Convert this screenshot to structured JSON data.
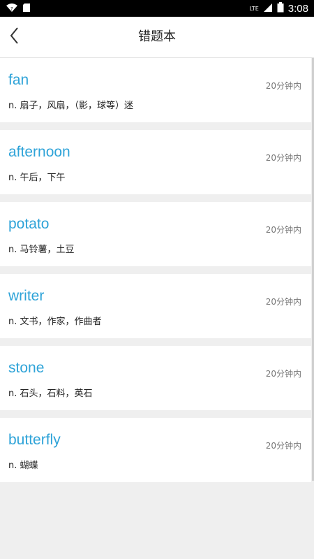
{
  "status_bar": {
    "time": "3:08",
    "network": "LTE"
  },
  "header": {
    "title": "错题本"
  },
  "items": [
    {
      "word": "fan",
      "meaning": "n. 扇子，风扇，（影，球等）迷",
      "time": "20分钟内"
    },
    {
      "word": "afternoon",
      "meaning": "n. 午后，下午",
      "time": "20分钟内"
    },
    {
      "word": "potato",
      "meaning": "n. 马铃薯，土豆",
      "time": "20分钟内"
    },
    {
      "word": "writer",
      "meaning": "n. 文书，作家，作曲者",
      "time": "20分钟内"
    },
    {
      "word": "stone",
      "meaning": "n. 石头，石料，英石",
      "time": "20分钟内"
    },
    {
      "word": "butterfly",
      "meaning": "n. 蝴蝶",
      "time": "20分钟内"
    }
  ]
}
